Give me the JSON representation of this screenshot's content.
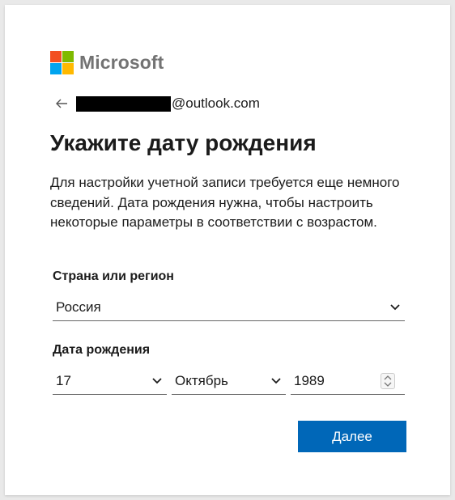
{
  "brand": {
    "name": "Microsoft",
    "colors": [
      "#f25022",
      "#7fba00",
      "#00a4ef",
      "#ffb900"
    ]
  },
  "identity": {
    "email_suffix": "@outlook.com"
  },
  "page": {
    "title": "Укажите дату рождения",
    "description": "Для настройки учетной записи требуется еще немного сведений. Дата рождения нужна, чтобы настроить некоторые параметры в соответствии с возрастом."
  },
  "country": {
    "label": "Страна или регион",
    "value": "Россия"
  },
  "birthdate": {
    "label": "Дата рождения",
    "day": "17",
    "month": "Октябрь",
    "year": "1989"
  },
  "actions": {
    "next_label": "Далее"
  },
  "accent_color": "#0067b8"
}
